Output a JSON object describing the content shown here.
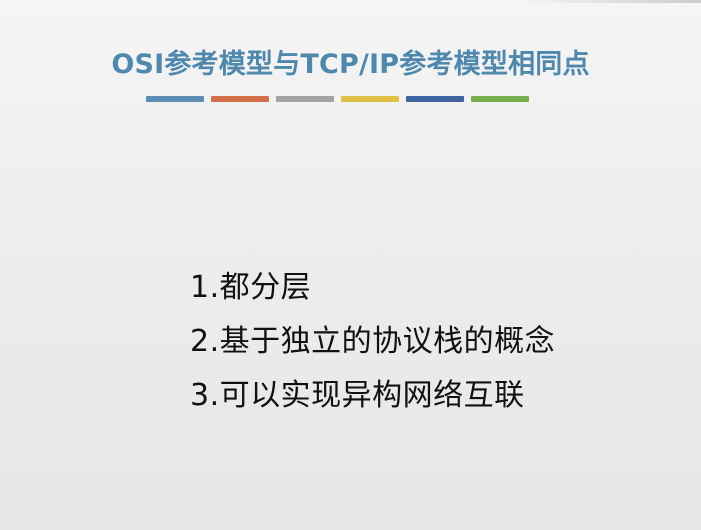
{
  "slide": {
    "title": "OSI参考模型与TCP/IP参考模型相同点",
    "colors": {
      "title": "#4f88ad",
      "bars": [
        "#5b8db6",
        "#d56f47",
        "#a2a2a2",
        "#e1c145",
        "#3f62a1",
        "#78b04d"
      ]
    },
    "points": [
      "1.都分层",
      "2.基于独立的协议栈的概念",
      "3.可以实现异构网络互联"
    ]
  }
}
